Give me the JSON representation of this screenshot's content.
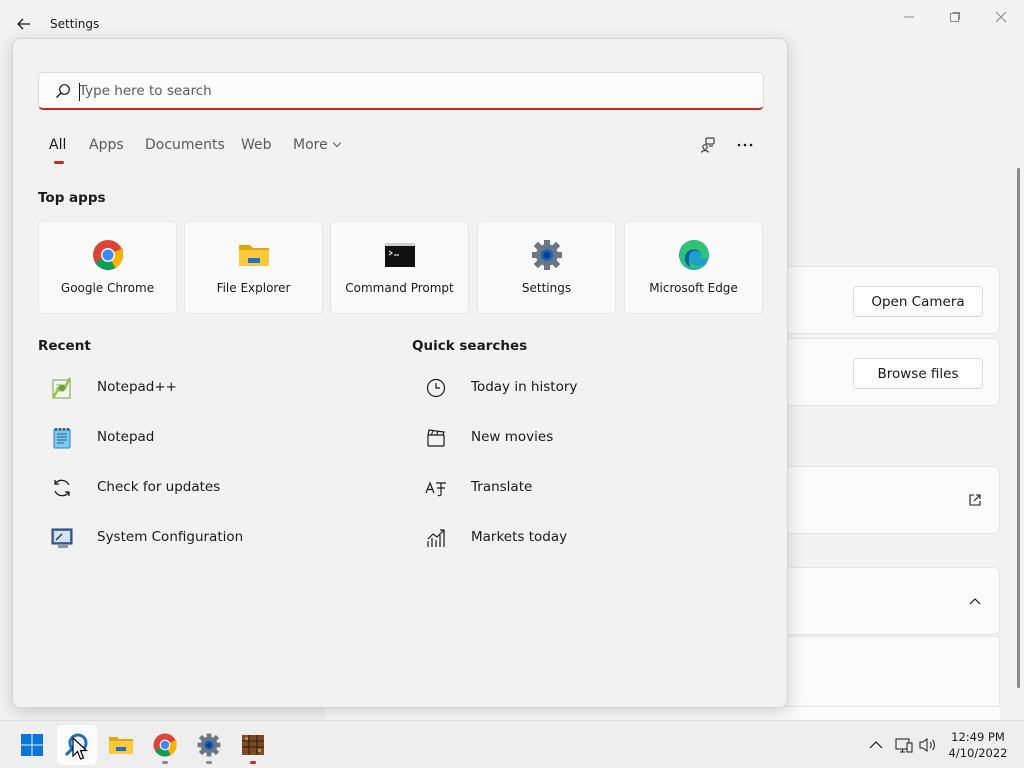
{
  "window": {
    "title": "Settings",
    "cards": {
      "open_camera_label": "Open Camera",
      "browse_files_label": "Browse files"
    }
  },
  "search": {
    "placeholder": "Type here to search",
    "value": ""
  },
  "tabs": [
    {
      "label": "All",
      "active": true
    },
    {
      "label": "Apps"
    },
    {
      "label": "Documents"
    },
    {
      "label": "Web"
    },
    {
      "label": "More"
    }
  ],
  "top_apps": {
    "title": "Top apps",
    "items": [
      {
        "label": "Google Chrome",
        "icon": "chrome-icon"
      },
      {
        "label": "File Explorer",
        "icon": "file-explorer-icon"
      },
      {
        "label": "Command Prompt",
        "icon": "command-prompt-icon"
      },
      {
        "label": "Settings",
        "icon": "settings-gear-icon"
      },
      {
        "label": "Microsoft Edge",
        "icon": "edge-icon"
      }
    ]
  },
  "recent": {
    "title": "Recent",
    "items": [
      {
        "label": "Notepad++",
        "icon": "notepad-plus-plus-icon"
      },
      {
        "label": "Notepad",
        "icon": "notepad-icon"
      },
      {
        "label": "Check for updates",
        "icon": "refresh-icon"
      },
      {
        "label": "System Configuration",
        "icon": "system-configuration-icon"
      }
    ]
  },
  "quick_searches": {
    "title": "Quick searches",
    "items": [
      {
        "label": "Today in history",
        "icon": "clock-icon"
      },
      {
        "label": "New movies",
        "icon": "clapperboard-icon"
      },
      {
        "label": "Translate",
        "icon": "translate-icon"
      },
      {
        "label": "Markets today",
        "icon": "chart-up-icon"
      }
    ]
  },
  "taskbar": {
    "clock_time": "12:49 PM",
    "clock_date": "4/10/2022"
  },
  "colors": {
    "accent": "#c42b1c",
    "panel": "#f2f2f2",
    "taskbar": "#eeeeee"
  }
}
